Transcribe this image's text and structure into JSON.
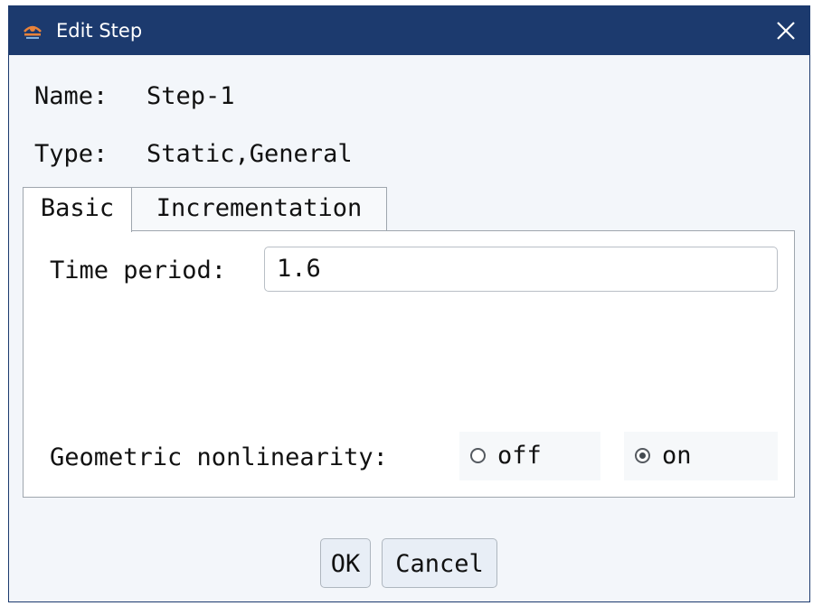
{
  "window": {
    "title": "Edit Step",
    "icon": "app-logo-icon",
    "close_icon": "close-icon",
    "titlebar_color": "#1c3a6e"
  },
  "fields": {
    "name_label": "Name:",
    "name_value": "Step-1",
    "type_label": "Type:",
    "type_value": "Static,General"
  },
  "tabs": [
    {
      "label": "Basic",
      "active": true
    },
    {
      "label": "Incrementation",
      "active": false
    }
  ],
  "basic": {
    "time_period_label": "Time period:",
    "time_period_value": "1.6",
    "geom_nonlin_label": "Geometric nonlinearity:",
    "options": [
      {
        "label": "off",
        "selected": false
      },
      {
        "label": "on",
        "selected": true
      }
    ]
  },
  "buttons": {
    "ok": "OK",
    "cancel": "Cancel"
  }
}
